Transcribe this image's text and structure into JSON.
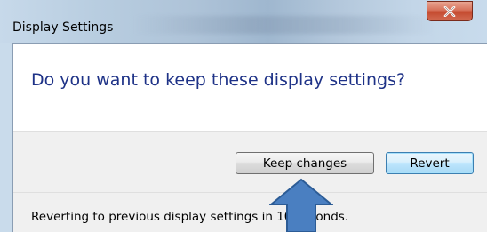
{
  "window": {
    "title": "Display Settings"
  },
  "titlebar": {
    "close_label": "X"
  },
  "dialog": {
    "question": "Do you want to keep these display settings?",
    "keep_button_label": "Keep changes",
    "revert_button_label": "Revert",
    "status_text": "Reverting to previous display settings in 10 seconds."
  },
  "icons": {
    "close": "close-icon",
    "annotation_arrow": "up-arrow-icon"
  },
  "colors": {
    "question_text": "#1e3287",
    "close_button": "#c44a2f",
    "annotation_arrow": "#4a7fc1",
    "default_button_border": "#3c7fb1"
  }
}
